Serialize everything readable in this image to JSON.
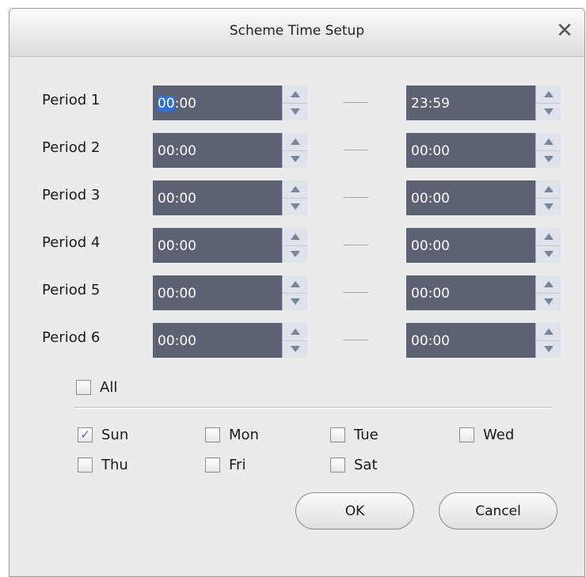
{
  "dialog": {
    "title": "Scheme Time Setup",
    "close_glyph": "✕"
  },
  "periods": [
    {
      "label": "Period 1",
      "start": "00:00",
      "start_selected": "00",
      "start_rest": ":00",
      "end": "23:59"
    },
    {
      "label": "Period 2",
      "start": "00:00",
      "end": "00:00"
    },
    {
      "label": "Period 3",
      "start": "00:00",
      "end": "00:00"
    },
    {
      "label": "Period 4",
      "start": "00:00",
      "end": "00:00"
    },
    {
      "label": "Period 5",
      "start": "00:00",
      "end": "00:00"
    },
    {
      "label": "Period 6",
      "start": "00:00",
      "end": "00:00"
    }
  ],
  "all_checkbox": {
    "label": "All",
    "checked": false
  },
  "days": [
    {
      "label": "Sun",
      "checked": true
    },
    {
      "label": "Mon",
      "checked": false
    },
    {
      "label": "Tue",
      "checked": false
    },
    {
      "label": "Wed",
      "checked": false
    },
    {
      "label": "Thu",
      "checked": false
    },
    {
      "label": "Fri",
      "checked": false
    },
    {
      "label": "Sat",
      "checked": false
    }
  ],
  "buttons": {
    "ok": "OK",
    "cancel": "Cancel"
  },
  "colors": {
    "time_field_bg": "#5c6274",
    "selection": "#2f6fd6",
    "check": "#3b66c6",
    "dialog_bg": "#ebebeb"
  }
}
